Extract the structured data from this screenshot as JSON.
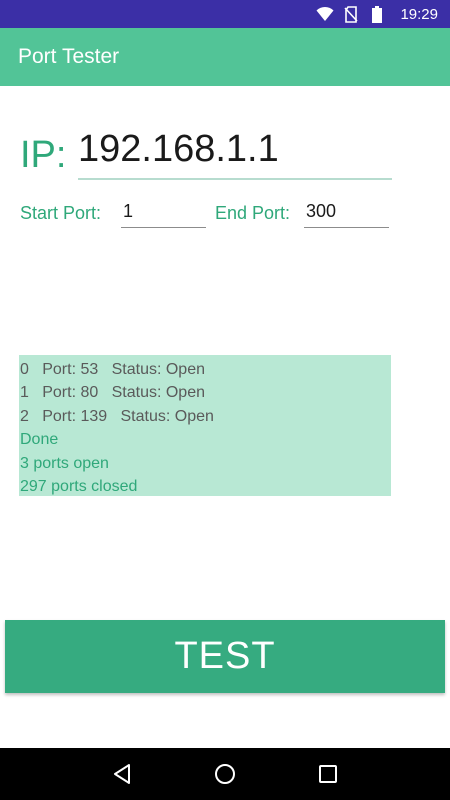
{
  "status_bar": {
    "time": "19:29",
    "icons": [
      "wifi-icon",
      "no-sim-icon",
      "battery-icon"
    ]
  },
  "app_bar": {
    "title": "Port Tester"
  },
  "form": {
    "ip_label": "IP:",
    "ip_value": "192.168.1.1",
    "start_port_label": "Start Port:",
    "start_port_value": "1",
    "end_port_label": "End Port:",
    "end_port_value": "300"
  },
  "results": {
    "lines": [
      "0   Port: 53   Status: Open",
      "1   Port: 80   Status: Open",
      "2   Port: 139   Status: Open",
      "Done",
      "3 ports open",
      "297 ports closed"
    ]
  },
  "actions": {
    "test_label": "TEST"
  },
  "nav_bar": {
    "buttons": [
      "back-icon",
      "home-icon",
      "recents-icon"
    ]
  },
  "colors": {
    "status_bar": "#3b2fa6",
    "app_bar": "#52c497",
    "accent_text": "#2fa87a",
    "results_bg": "#b8e8d4",
    "button": "#36ab80"
  }
}
